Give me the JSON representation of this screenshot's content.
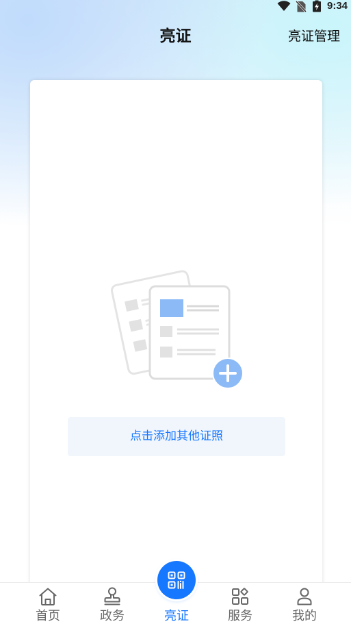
{
  "status_bar": {
    "time": "9:34",
    "icons": [
      "wifi-icon",
      "no-sim-icon",
      "battery-charging-icon"
    ]
  },
  "header": {
    "title": "亮证",
    "manage_label": "亮证管理"
  },
  "card": {
    "illustration_icon": "empty-certificate-add-icon",
    "add_button_label": "点击添加其他证照"
  },
  "tabbar": {
    "active_index": 2,
    "items": [
      {
        "label": "首页",
        "icon": "home-icon"
      },
      {
        "label": "政务",
        "icon": "stamp-icon"
      },
      {
        "label": "亮证",
        "icon": "qr-code-icon"
      },
      {
        "label": "服务",
        "icon": "services-grid-icon"
      },
      {
        "label": "我的",
        "icon": "person-icon"
      }
    ]
  },
  "colors": {
    "accent": "#1677ff",
    "button_bg": "#f1f6fd",
    "tab_text": "#666666",
    "illustration_blue": "#8cbaf7",
    "illustration_gray": "#e2e2e2"
  }
}
